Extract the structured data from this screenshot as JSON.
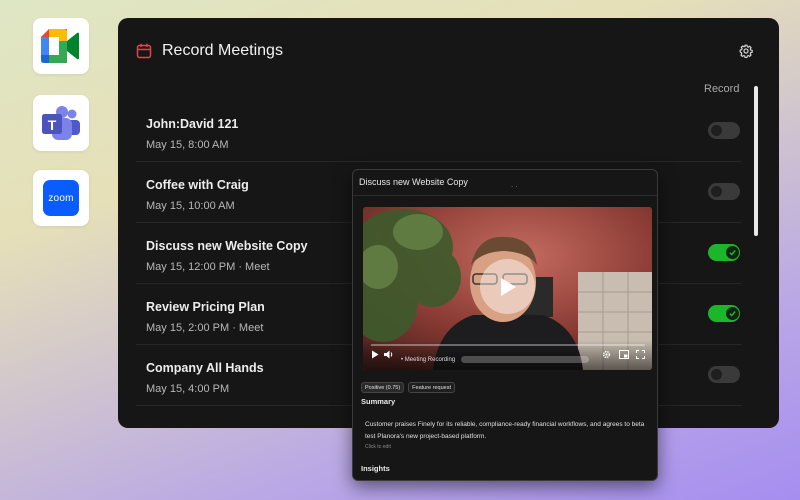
{
  "app_icons": [
    {
      "name": "Google Meet",
      "icon": "google-meet-icon"
    },
    {
      "name": "Microsoft Teams",
      "icon": "teams-icon"
    },
    {
      "name": "Zoom",
      "icon": "zoom-icon",
      "text": "zoom"
    }
  ],
  "panel": {
    "title": "Record Meetings",
    "record_column_label": "Record",
    "colors": {
      "toggle_on": "#1bb62a",
      "title_icon": "#e0444e"
    }
  },
  "meetings": [
    {
      "title": "John:David 121",
      "time": "May 15, 8:00 AM",
      "record": false
    },
    {
      "title": "Coffee with Craig",
      "time": "May 15, 10:00 AM",
      "record": false
    },
    {
      "title": "Discuss new Website Copy",
      "time": "May 15, 12:00 PM  ·  Meet",
      "record": true
    },
    {
      "title": "Review Pricing Plan",
      "time": "May 15, 2:00 PM  ·  Meet",
      "record": true
    },
    {
      "title": "Company All Hands",
      "time": "May 15, 4:00 PM",
      "record": false
    }
  ],
  "popup": {
    "title": "Discuss new Website Copy",
    "dots": ". .",
    "video_label": "• Meeting Recording",
    "tags": [
      "Positive (0.75)",
      "Feature request"
    ],
    "summary_heading": "Summary",
    "summary_text": "Customer praises Finely for its reliable, compliance-ready financial workflows, and agrees to beta test Planora's new project-based platform.",
    "click_to_edit": "Click to edit",
    "insights_heading": "Insights"
  }
}
